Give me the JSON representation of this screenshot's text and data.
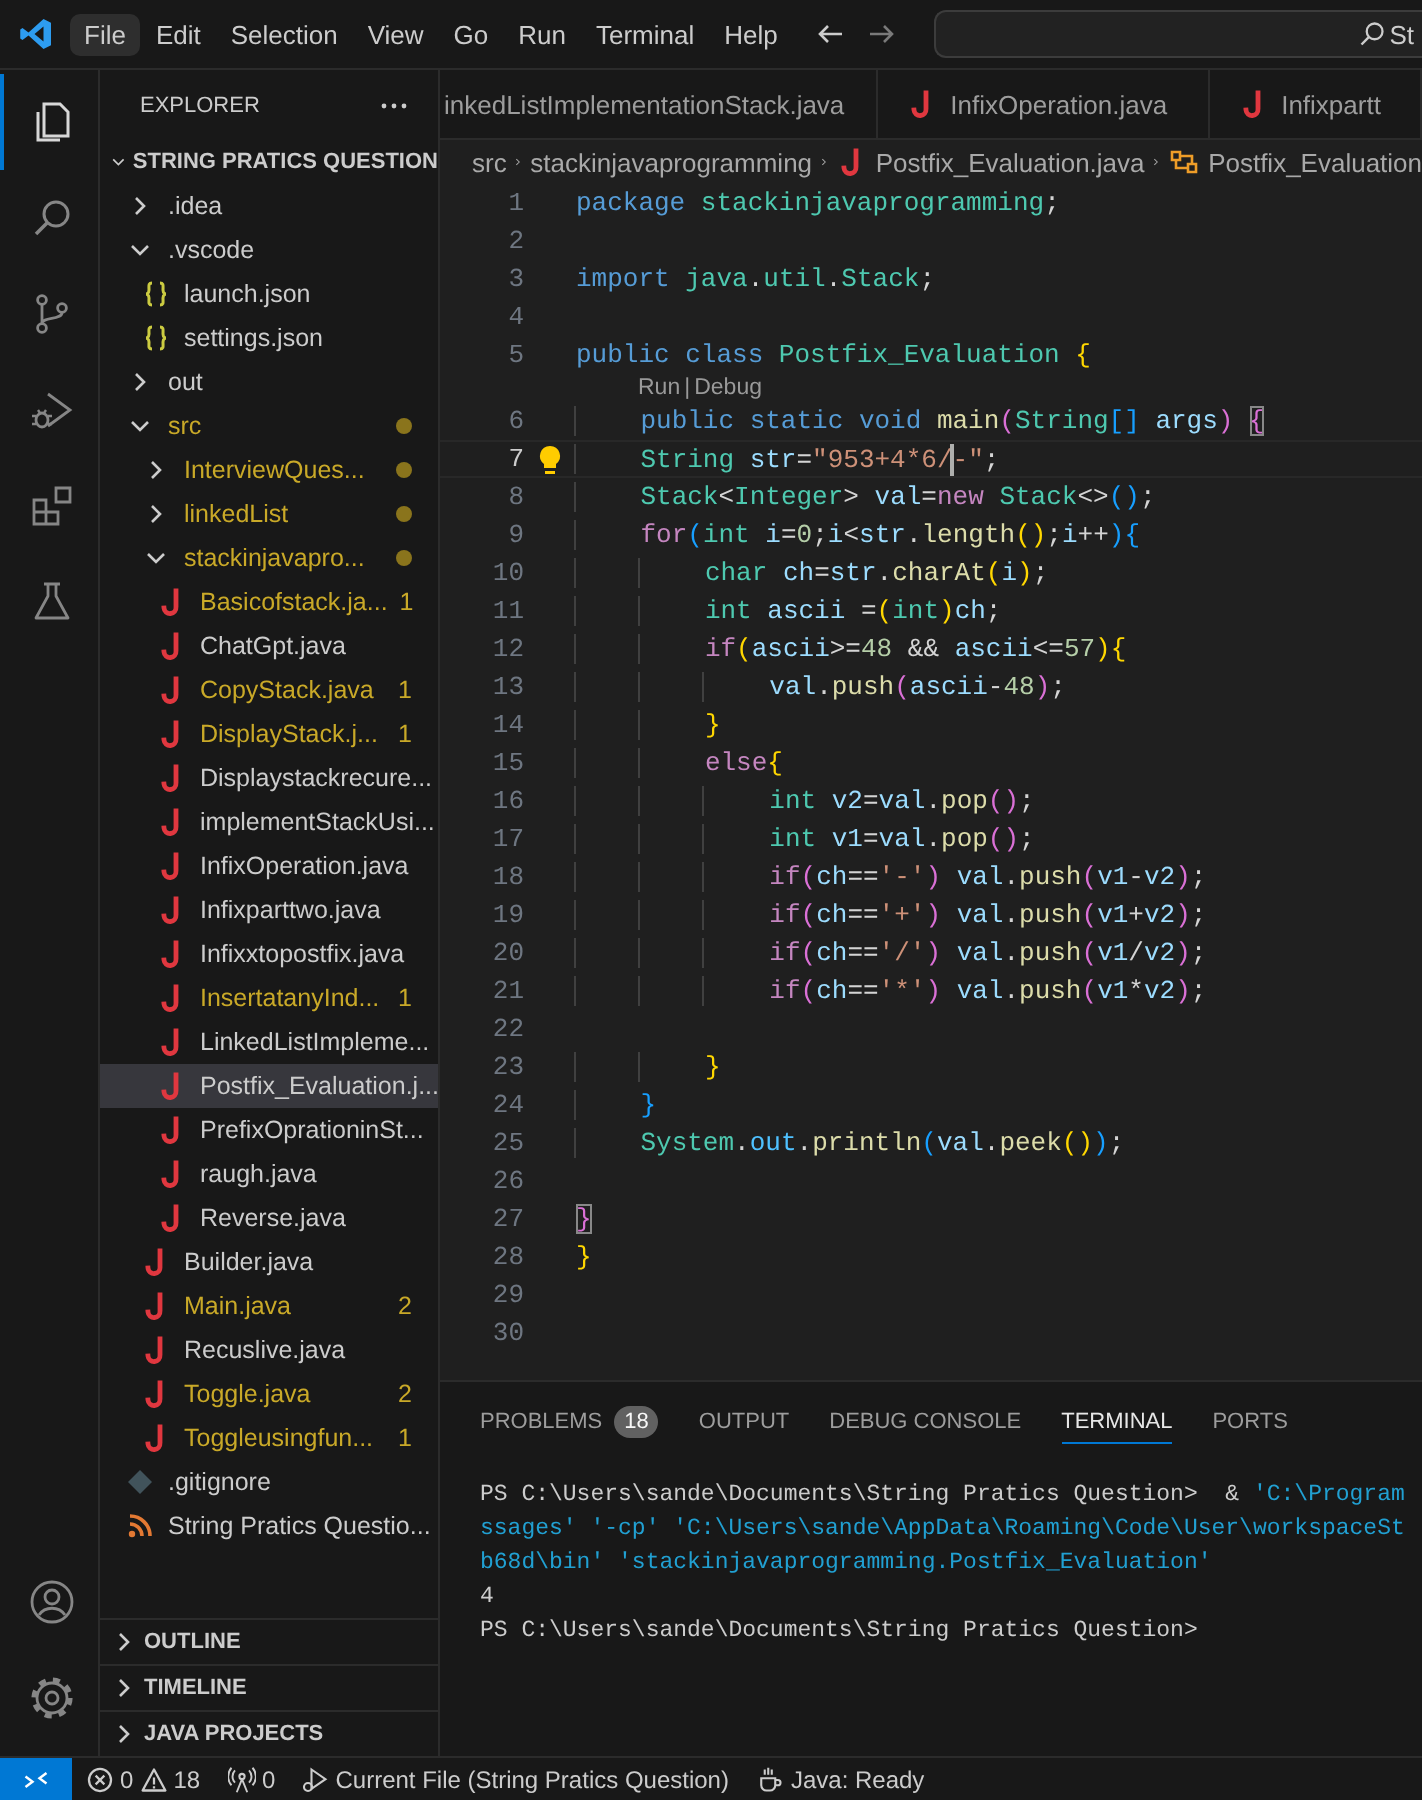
{
  "menu_bar": {
    "items": [
      {
        "label": "File",
        "selected": true
      },
      {
        "label": "Edit",
        "selected": false
      },
      {
        "label": "Selection",
        "selected": false
      },
      {
        "label": "View",
        "selected": false
      },
      {
        "label": "Go",
        "selected": false
      },
      {
        "label": "Run",
        "selected": false
      },
      {
        "label": "Terminal",
        "selected": false
      },
      {
        "label": "Help",
        "selected": false
      }
    ],
    "command_center": "St"
  },
  "activity_bar": {
    "items": [
      {
        "kind": "explorer",
        "selected": true
      },
      {
        "kind": "search",
        "selected": false
      },
      {
        "kind": "source-control",
        "selected": false
      },
      {
        "kind": "run-debug",
        "selected": false
      },
      {
        "kind": "extensions",
        "selected": false
      },
      {
        "kind": "testing",
        "selected": false
      }
    ],
    "bottom": [
      {
        "kind": "account"
      },
      {
        "kind": "settings"
      }
    ]
  },
  "sidebar": {
    "title": "EXPLORER",
    "root": {
      "label": "STRING PRATICS QUESTION",
      "expanded": true
    },
    "tree": [
      {
        "label": ".idea",
        "kind": "folder",
        "expanded": false,
        "modified": false,
        "selected": false
      },
      {
        "label": ".vscode",
        "kind": "folder",
        "expanded": true,
        "modified": false,
        "selected": false,
        "children": [
          {
            "label": "launch.json",
            "kind": "json",
            "modified": false,
            "selected": false
          },
          {
            "label": "settings.json",
            "kind": "json",
            "modified": false,
            "selected": false
          }
        ]
      },
      {
        "label": "out",
        "kind": "folder",
        "expanded": false,
        "modified": false,
        "selected": false
      },
      {
        "label": "src",
        "kind": "folder",
        "expanded": true,
        "modified": true,
        "selected": false,
        "children": [
          {
            "label": "InterviewQues...",
            "kind": "folder",
            "expanded": false,
            "modified": true,
            "selected": false
          },
          {
            "label": "linkedList",
            "kind": "folder",
            "expanded": false,
            "modified": true,
            "selected": false
          },
          {
            "label": "stackinjavapro...",
            "kind": "folder",
            "expanded": true,
            "modified": true,
            "selected": false,
            "children": [
              {
                "label": "Basicofstack.ja...",
                "kind": "java",
                "modified": true,
                "badge": "1",
                "selected": false
              },
              {
                "label": "ChatGpt.java",
                "kind": "java",
                "modified": false,
                "selected": false
              },
              {
                "label": "CopyStack.java",
                "kind": "java",
                "modified": true,
                "badge": "1",
                "selected": false
              },
              {
                "label": "DisplayStack.j...",
                "kind": "java",
                "modified": true,
                "badge": "1",
                "selected": false
              },
              {
                "label": "Displaystackrecure...",
                "kind": "java",
                "modified": false,
                "selected": false
              },
              {
                "label": "implementStackUsi...",
                "kind": "java",
                "modified": false,
                "selected": false
              },
              {
                "label": "InfixOperation.java",
                "kind": "java",
                "modified": false,
                "selected": false
              },
              {
                "label": "Infixparttwo.java",
                "kind": "java",
                "modified": false,
                "selected": false
              },
              {
                "label": "Infixxtopostfix.java",
                "kind": "java",
                "modified": false,
                "selected": false
              },
              {
                "label": "InsertatanyInd...",
                "kind": "java",
                "modified": true,
                "badge": "1",
                "selected": false
              },
              {
                "label": "LinkedListImpleme...",
                "kind": "java",
                "modified": false,
                "selected": false
              },
              {
                "label": "Postfix_Evaluation.j...",
                "kind": "java",
                "modified": false,
                "selected": true
              },
              {
                "label": "PrefixOprationinSt...",
                "kind": "java",
                "modified": false,
                "selected": false
              },
              {
                "label": "raugh.java",
                "kind": "java",
                "modified": false,
                "selected": false
              },
              {
                "label": "Reverse.java",
                "kind": "java",
                "modified": false,
                "selected": false
              }
            ]
          },
          {
            "label": "Builder.java",
            "kind": "java",
            "modified": false,
            "selected": false
          },
          {
            "label": "Main.java",
            "kind": "java",
            "modified": true,
            "badge": "2",
            "selected": false
          },
          {
            "label": "Recuslive.java",
            "kind": "java",
            "modified": false,
            "selected": false
          },
          {
            "label": "Toggle.java",
            "kind": "java",
            "modified": true,
            "badge": "2",
            "selected": false
          },
          {
            "label": "Toggleusingfun...",
            "kind": "java",
            "modified": true,
            "badge": "1",
            "selected": false
          }
        ]
      },
      {
        "label": ".gitignore",
        "kind": "git",
        "modified": false,
        "selected": false
      },
      {
        "label": "String Pratics Questio...",
        "kind": "project",
        "modified": false,
        "selected": false
      }
    ],
    "sections": [
      {
        "label": "OUTLINE",
        "expanded": false
      },
      {
        "label": "TIMELINE",
        "expanded": false
      },
      {
        "label": "JAVA PROJECTS",
        "expanded": false
      }
    ]
  },
  "editor": {
    "tabs": [
      {
        "label": "inkedListImplementationStack.java",
        "cut": true,
        "selected": false
      },
      {
        "label": "InfixOperation.java",
        "cut": false,
        "selected": false
      },
      {
        "label": "Infixpartt",
        "cut": false,
        "selected": false
      }
    ],
    "breadcrumb": [
      {
        "label": "src",
        "kind": "folder"
      },
      {
        "label": "stackinjavaprogramming",
        "kind": "folder"
      },
      {
        "label": "Postfix_Evaluation.java",
        "kind": "java"
      },
      {
        "label": "Postfix_Evaluation",
        "kind": "class"
      }
    ],
    "lines": [
      {
        "kind": "code",
        "number": "1",
        "active": false,
        "lightbulb": false,
        "tokens": [
          {
            "kind": "kw",
            "text": "package "
          },
          {
            "kind": "ty",
            "text": "stackinjavaprogramming"
          },
          {
            "kind": "p",
            "text": ";"
          }
        ]
      },
      {
        "kind": "code",
        "number": "2",
        "active": false,
        "lightbulb": false
      },
      {
        "kind": "code",
        "number": "3",
        "active": false,
        "lightbulb": false,
        "tokens": [
          {
            "kind": "kw",
            "text": "import "
          },
          {
            "kind": "ty",
            "text": "java"
          },
          {
            "kind": "p",
            "text": "."
          },
          {
            "kind": "ty",
            "text": "util"
          },
          {
            "kind": "p",
            "text": "."
          },
          {
            "kind": "ty",
            "text": "Stack"
          },
          {
            "kind": "p",
            "text": ";"
          }
        ]
      },
      {
        "kind": "code",
        "number": "4",
        "active": false,
        "lightbulb": false
      },
      {
        "kind": "code",
        "number": "5",
        "active": false,
        "lightbulb": false,
        "tokens": [
          {
            "kind": "kw",
            "text": "public "
          },
          {
            "kind": "kw",
            "text": "class "
          },
          {
            "kind": "ty",
            "text": "Postfix_Evaluation "
          },
          {
            "kind": "g",
            "text": "{"
          }
        ]
      },
      {
        "kind": "codelens",
        "actions": [
          "Run",
          "Debug"
        ],
        "separator": "|"
      },
      {
        "kind": "code",
        "number": "6",
        "active": false,
        "lightbulb": false,
        "tokens": [
          {
            "kind": "kw",
            "text": "    public "
          },
          {
            "kind": "kw",
            "text": "static "
          },
          {
            "kind": "kw",
            "text": "void "
          },
          {
            "kind": "fn",
            "text": "main"
          },
          {
            "kind": "o",
            "text": "("
          },
          {
            "kind": "ty",
            "text": "String"
          },
          {
            "kind": "b",
            "text": "[] "
          },
          {
            "kind": "v",
            "text": "args"
          },
          {
            "kind": "o",
            "text": ") "
          },
          {
            "kind": "om",
            "text": "{"
          }
        ]
      },
      {
        "kind": "code",
        "number": "7",
        "active": true,
        "lightbulb": true,
        "tokens": [
          {
            "kind": "ty",
            "text": "    String "
          },
          {
            "kind": "v",
            "text": "str"
          },
          {
            "kind": "p",
            "text": "="
          },
          {
            "kind": "s",
            "text": "\"953+4*6/"
          },
          {
            "kind": "cursor"
          },
          {
            "kind": "s",
            "text": "-\""
          },
          {
            "kind": "p",
            "text": ";"
          }
        ]
      },
      {
        "kind": "code",
        "number": "8",
        "active": false,
        "lightbulb": false,
        "tokens": [
          {
            "kind": "ty",
            "text": "    Stack"
          },
          {
            "kind": "p",
            "text": "<"
          },
          {
            "kind": "ty",
            "text": "Integer"
          },
          {
            "kind": "p",
            "text": "> "
          },
          {
            "kind": "v",
            "text": "val"
          },
          {
            "kind": "p",
            "text": "="
          },
          {
            "kind": "c",
            "text": "new "
          },
          {
            "kind": "ty",
            "text": "Stack"
          },
          {
            "kind": "p",
            "text": "<>"
          },
          {
            "kind": "b",
            "text": "()"
          },
          {
            "kind": "p",
            "text": ";"
          }
        ]
      },
      {
        "kind": "code",
        "number": "9",
        "active": false,
        "lightbulb": false,
        "tokens": [
          {
            "kind": "c",
            "text": "    for"
          },
          {
            "kind": "b",
            "text": "("
          },
          {
            "kind": "ty",
            "text": "int "
          },
          {
            "kind": "v",
            "text": "i"
          },
          {
            "kind": "p",
            "text": "="
          },
          {
            "kind": "n",
            "text": "0"
          },
          {
            "kind": "p",
            "text": ";"
          },
          {
            "kind": "v",
            "text": "i"
          },
          {
            "kind": "p",
            "text": "<"
          },
          {
            "kind": "v",
            "text": "str"
          },
          {
            "kind": "p",
            "text": "."
          },
          {
            "kind": "fn",
            "text": "length"
          },
          {
            "kind": "g",
            "text": "()"
          },
          {
            "kind": "p",
            "text": ";"
          },
          {
            "kind": "v",
            "text": "i"
          },
          {
            "kind": "p",
            "text": "++"
          },
          {
            "kind": "b",
            "text": ")"
          },
          {
            "kind": "b",
            "text": "{"
          }
        ]
      },
      {
        "kind": "code",
        "number": "10",
        "active": false,
        "lightbulb": false,
        "tokens": [
          {
            "kind": "ty",
            "text": "        char "
          },
          {
            "kind": "v",
            "text": "ch"
          },
          {
            "kind": "p",
            "text": "="
          },
          {
            "kind": "v",
            "text": "str"
          },
          {
            "kind": "p",
            "text": "."
          },
          {
            "kind": "fn",
            "text": "charAt"
          },
          {
            "kind": "g",
            "text": "("
          },
          {
            "kind": "v",
            "text": "i"
          },
          {
            "kind": "g",
            "text": ")"
          },
          {
            "kind": "p",
            "text": ";"
          }
        ]
      },
      {
        "kind": "code",
        "number": "11",
        "active": false,
        "lightbulb": false,
        "tokens": [
          {
            "kind": "ty",
            "text": "        int "
          },
          {
            "kind": "v",
            "text": "ascii"
          },
          {
            "kind": "p",
            "text": " ="
          },
          {
            "kind": "g",
            "text": "("
          },
          {
            "kind": "ty",
            "text": "int"
          },
          {
            "kind": "g",
            "text": ")"
          },
          {
            "kind": "v",
            "text": "ch"
          },
          {
            "kind": "p",
            "text": ";"
          }
        ]
      },
      {
        "kind": "code",
        "number": "12",
        "active": false,
        "lightbulb": false,
        "tokens": [
          {
            "kind": "c",
            "text": "        if"
          },
          {
            "kind": "g",
            "text": "("
          },
          {
            "kind": "v",
            "text": "ascii"
          },
          {
            "kind": "p",
            "text": ">="
          },
          {
            "kind": "n",
            "text": "48"
          },
          {
            "kind": "p",
            "text": " && "
          },
          {
            "kind": "v",
            "text": "ascii"
          },
          {
            "kind": "p",
            "text": "<="
          },
          {
            "kind": "n",
            "text": "57"
          },
          {
            "kind": "g",
            "text": ")"
          },
          {
            "kind": "g",
            "text": "{"
          }
        ]
      },
      {
        "kind": "code",
        "number": "13",
        "active": false,
        "lightbulb": false,
        "tokens": [
          {
            "kind": "v",
            "text": "            val"
          },
          {
            "kind": "p",
            "text": "."
          },
          {
            "kind": "fn",
            "text": "push"
          },
          {
            "kind": "o",
            "text": "("
          },
          {
            "kind": "v",
            "text": "ascii"
          },
          {
            "kind": "p",
            "text": "-"
          },
          {
            "kind": "n",
            "text": "48"
          },
          {
            "kind": "o",
            "text": ")"
          },
          {
            "kind": "p",
            "text": ";"
          }
        ]
      },
      {
        "kind": "code",
        "number": "14",
        "active": false,
        "lightbulb": false,
        "tokens": [
          {
            "kind": "g",
            "text": "        }"
          }
        ]
      },
      {
        "kind": "code",
        "number": "15",
        "active": false,
        "lightbulb": false,
        "tokens": [
          {
            "kind": "c",
            "text": "        else"
          },
          {
            "kind": "g",
            "text": "{"
          }
        ]
      },
      {
        "kind": "code",
        "number": "16",
        "active": false,
        "lightbulb": false,
        "tokens": [
          {
            "kind": "ty",
            "text": "            int "
          },
          {
            "kind": "v",
            "text": "v2"
          },
          {
            "kind": "p",
            "text": "="
          },
          {
            "kind": "v",
            "text": "val"
          },
          {
            "kind": "p",
            "text": "."
          },
          {
            "kind": "fn",
            "text": "pop"
          },
          {
            "kind": "o",
            "text": "()"
          },
          {
            "kind": "p",
            "text": ";"
          }
        ]
      },
      {
        "kind": "code",
        "number": "17",
        "active": false,
        "lightbulb": false,
        "tokens": [
          {
            "kind": "ty",
            "text": "            int "
          },
          {
            "kind": "v",
            "text": "v1"
          },
          {
            "kind": "p",
            "text": "="
          },
          {
            "kind": "v",
            "text": "val"
          },
          {
            "kind": "p",
            "text": "."
          },
          {
            "kind": "fn",
            "text": "pop"
          },
          {
            "kind": "o",
            "text": "()"
          },
          {
            "kind": "p",
            "text": ";"
          }
        ]
      },
      {
        "kind": "code",
        "number": "18",
        "active": false,
        "lightbulb": false,
        "tokens": [
          {
            "kind": "c",
            "text": "            if"
          },
          {
            "kind": "o",
            "text": "("
          },
          {
            "kind": "v",
            "text": "ch"
          },
          {
            "kind": "p",
            "text": "=="
          },
          {
            "kind": "s",
            "text": "'-'"
          },
          {
            "kind": "o",
            "text": ") "
          },
          {
            "kind": "v",
            "text": "val"
          },
          {
            "kind": "p",
            "text": "."
          },
          {
            "kind": "fn",
            "text": "push"
          },
          {
            "kind": "o",
            "text": "("
          },
          {
            "kind": "v",
            "text": "v1"
          },
          {
            "kind": "p",
            "text": "-"
          },
          {
            "kind": "v",
            "text": "v2"
          },
          {
            "kind": "o",
            "text": ")"
          },
          {
            "kind": "p",
            "text": ";"
          }
        ]
      },
      {
        "kind": "code",
        "number": "19",
        "active": false,
        "lightbulb": false,
        "tokens": [
          {
            "kind": "c",
            "text": "            if"
          },
          {
            "kind": "o",
            "text": "("
          },
          {
            "kind": "v",
            "text": "ch"
          },
          {
            "kind": "p",
            "text": "=="
          },
          {
            "kind": "s",
            "text": "'+'"
          },
          {
            "kind": "o",
            "text": ") "
          },
          {
            "kind": "v",
            "text": "val"
          },
          {
            "kind": "p",
            "text": "."
          },
          {
            "kind": "fn",
            "text": "push"
          },
          {
            "kind": "o",
            "text": "("
          },
          {
            "kind": "v",
            "text": "v1"
          },
          {
            "kind": "p",
            "text": "+"
          },
          {
            "kind": "v",
            "text": "v2"
          },
          {
            "kind": "o",
            "text": ")"
          },
          {
            "kind": "p",
            "text": ";"
          }
        ]
      },
      {
        "kind": "code",
        "number": "20",
        "active": false,
        "lightbulb": false,
        "tokens": [
          {
            "kind": "c",
            "text": "            if"
          },
          {
            "kind": "o",
            "text": "("
          },
          {
            "kind": "v",
            "text": "ch"
          },
          {
            "kind": "p",
            "text": "=="
          },
          {
            "kind": "s",
            "text": "'/'"
          },
          {
            "kind": "o",
            "text": ") "
          },
          {
            "kind": "v",
            "text": "val"
          },
          {
            "kind": "p",
            "text": "."
          },
          {
            "kind": "fn",
            "text": "push"
          },
          {
            "kind": "o",
            "text": "("
          },
          {
            "kind": "v",
            "text": "v1"
          },
          {
            "kind": "p",
            "text": "/"
          },
          {
            "kind": "v",
            "text": "v2"
          },
          {
            "kind": "o",
            "text": ")"
          },
          {
            "kind": "p",
            "text": ";"
          }
        ]
      },
      {
        "kind": "code",
        "number": "21",
        "active": false,
        "lightbulb": false,
        "tokens": [
          {
            "kind": "c",
            "text": "            if"
          },
          {
            "kind": "o",
            "text": "("
          },
          {
            "kind": "v",
            "text": "ch"
          },
          {
            "kind": "p",
            "text": "=="
          },
          {
            "kind": "s",
            "text": "'*'"
          },
          {
            "kind": "o",
            "text": ") "
          },
          {
            "kind": "v",
            "text": "val"
          },
          {
            "kind": "p",
            "text": "."
          },
          {
            "kind": "fn",
            "text": "push"
          },
          {
            "kind": "o",
            "text": "("
          },
          {
            "kind": "v",
            "text": "v1"
          },
          {
            "kind": "p",
            "text": "*"
          },
          {
            "kind": "v",
            "text": "v2"
          },
          {
            "kind": "o",
            "text": ")"
          },
          {
            "kind": "p",
            "text": ";"
          }
        ]
      },
      {
        "kind": "code",
        "number": "22",
        "active": false,
        "lightbulb": false
      },
      {
        "kind": "code",
        "number": "23",
        "active": false,
        "lightbulb": false,
        "tokens": [
          {
            "kind": "g",
            "text": "        }"
          }
        ]
      },
      {
        "kind": "code",
        "number": "24",
        "active": false,
        "lightbulb": false,
        "tokens": [
          {
            "kind": "b",
            "text": "    }"
          }
        ]
      },
      {
        "kind": "code",
        "number": "25",
        "active": false,
        "lightbulb": false,
        "tokens": [
          {
            "kind": "ty",
            "text": "    System"
          },
          {
            "kind": "p",
            "text": "."
          },
          {
            "kind": "prop",
            "text": "out"
          },
          {
            "kind": "p",
            "text": "."
          },
          {
            "kind": "fn",
            "text": "println"
          },
          {
            "kind": "b",
            "text": "("
          },
          {
            "kind": "v",
            "text": "val"
          },
          {
            "kind": "p",
            "text": "."
          },
          {
            "kind": "fn",
            "text": "peek"
          },
          {
            "kind": "g",
            "text": "()"
          },
          {
            "kind": "b",
            "text": ")"
          },
          {
            "kind": "p",
            "text": ";"
          }
        ]
      },
      {
        "kind": "code",
        "number": "26",
        "active": false,
        "lightbulb": false
      },
      {
        "kind": "code",
        "number": "27",
        "active": false,
        "lightbulb": false,
        "tokens": [
          {
            "kind": "om",
            "text": "}"
          }
        ]
      },
      {
        "kind": "code",
        "number": "28",
        "active": false,
        "lightbulb": false,
        "tokens": [
          {
            "kind": "g",
            "text": "}"
          }
        ]
      },
      {
        "kind": "code",
        "number": "29",
        "active": false,
        "lightbulb": false
      },
      {
        "kind": "code",
        "number": "30",
        "active": false,
        "lightbulb": false
      }
    ]
  },
  "panel": {
    "tabs": [
      {
        "label": "PROBLEMS",
        "badge": "18",
        "selected": false
      },
      {
        "label": "OUTPUT",
        "selected": false
      },
      {
        "label": "DEBUG CONSOLE",
        "selected": false
      },
      {
        "label": "TERMINAL",
        "selected": true
      },
      {
        "label": "PORTS",
        "selected": false
      }
    ],
    "terminal": [
      {
        "tokens": [
          {
            "kind": "p",
            "text": "PS C:\\Users\\sande\\Documents\\String Pratics Question>  & "
          },
          {
            "kind": "s",
            "text": "'C:\\Program"
          }
        ]
      },
      {
        "tokens": [
          {
            "kind": "s",
            "text": "ssages' '-cp' 'C:\\Users\\sande\\AppData\\Roaming\\Code\\User\\workspaceSt"
          }
        ]
      },
      {
        "tokens": [
          {
            "kind": "s",
            "text": "b68d\\bin' 'stackinjavaprogramming.Postfix_Evaluation'"
          }
        ]
      },
      {
        "tokens": [
          {
            "kind": "p",
            "text": "4"
          }
        ]
      },
      {
        "tokens": [
          {
            "kind": "p",
            "text": "PS C:\\Users\\sande\\Documents\\String Pratics Question>"
          }
        ]
      }
    ]
  },
  "status_bar": {
    "items": [
      {
        "kind": "remote"
      },
      {
        "kind": "errors",
        "text": "0"
      },
      {
        "kind": "warnings",
        "text": "18"
      },
      {
        "kind": "ports",
        "text": "0"
      },
      {
        "kind": "run",
        "text": "Current File (String Pratics Question)"
      },
      {
        "kind": "java",
        "text": "Java: Ready"
      }
    ]
  }
}
